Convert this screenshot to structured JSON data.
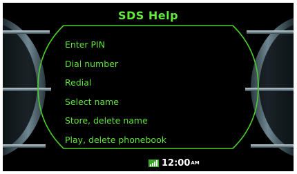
{
  "header": {
    "title": "SDS Help"
  },
  "menu": {
    "items": [
      {
        "label": "Enter PIN"
      },
      {
        "label": "Dial number"
      },
      {
        "label": "Redial"
      },
      {
        "label": "Select name"
      },
      {
        "label": "Store, delete name"
      },
      {
        "label": "Play, delete phonebook"
      }
    ]
  },
  "status": {
    "time": "12:00",
    "meridiem": "AM",
    "signal_icon": "signal-strength-icon"
  },
  "colors": {
    "accent": "#63ea3d",
    "background": "#000000",
    "chrome": "#4f6670"
  }
}
